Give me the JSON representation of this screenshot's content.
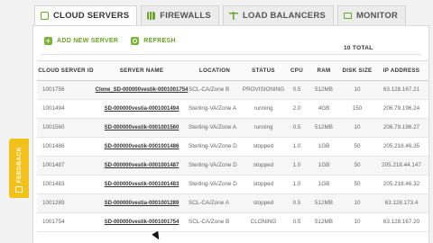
{
  "tabs": [
    {
      "label": "CLOUD SERVERS",
      "icon": "cloud-icon",
      "active": true
    },
    {
      "label": "FIREWALLS",
      "icon": "firewall-icon",
      "active": false
    },
    {
      "label": "LOAD BALANCERS",
      "icon": "load-balancer-icon",
      "active": false
    },
    {
      "label": "MONITOR",
      "icon": "monitor-icon",
      "active": false
    }
  ],
  "actions": {
    "add_server": "ADD NEW SERVER",
    "refresh": "REFRESH"
  },
  "total": "10 TOTAL",
  "feedback": {
    "label": "FEEDBACK"
  },
  "table": {
    "columns": [
      "CLOUD SERVER ID",
      "SERVER NAME",
      "LOCATION",
      "STATUS",
      "CPU",
      "RAM",
      "DISK SIZE",
      "IP ADDRESS"
    ],
    "rows": [
      {
        "id": "1001756",
        "name": "Clone_SD-000000vestik-0001001754",
        "location": "SCL-CA/Zone B",
        "status": "PROVISIONING",
        "cpu": "0.5",
        "ram": "512MB",
        "disk": "10",
        "ip": "63.128.167.21"
      },
      {
        "id": "1001494",
        "name": "SD-000000vestia-0001001494",
        "location": "Sterling-VA/Zone A",
        "status": "running",
        "cpu": "2.0",
        "ram": "4GB",
        "disk": "150",
        "ip": "206.79.196.24"
      },
      {
        "id": "1001560",
        "name": "SD-000000vestik-0001001560",
        "location": "Sterling-VA/Zone A",
        "status": "running",
        "cpu": "0.5",
        "ram": "512MB",
        "disk": "10",
        "ip": "206.79.196.27"
      },
      {
        "id": "1001486",
        "name": "SD-000000vestik-0001001486",
        "location": "Sterling-VA/Zone D",
        "status": "stopped",
        "cpu": "1.0",
        "ram": "1GB",
        "disk": "50",
        "ip": "205.218.46.35"
      },
      {
        "id": "1001487",
        "name": "SD-000000vestik-0001001487",
        "location": "Sterling-VA/Zone D",
        "status": "stopped",
        "cpu": "1.0",
        "ram": "1GB",
        "disk": "50",
        "ip": "205.218.44.147"
      },
      {
        "id": "1001483",
        "name": "SD-000000vestik-0001001483",
        "location": "Sterling-VA/Zone D",
        "status": "stopped",
        "cpu": "1.0",
        "ram": "1GB",
        "disk": "50",
        "ip": "205.218.46.32"
      },
      {
        "id": "1001289",
        "name": "SD-000000vestia-0001001289",
        "location": "SCL-CA/Zone A",
        "status": "stopped",
        "cpu": "0.5",
        "ram": "512MB",
        "disk": "10",
        "ip": "63.128.173.4"
      },
      {
        "id": "1001754",
        "name": "SD-000000vestik-0001001754",
        "location": "SCL-CA/Zone B",
        "status": "CLONING",
        "cpu": "0.5",
        "ram": "512MB",
        "disk": "10",
        "ip": "63.128.167.20"
      }
    ]
  },
  "colors": {
    "accent": "#6aa52a",
    "feedback": "#f3c21a"
  }
}
